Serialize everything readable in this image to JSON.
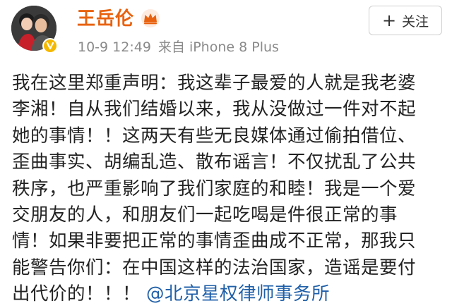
{
  "post": {
    "author": {
      "name": "王岳伦",
      "avatar": "avatar",
      "badge": "verified-badge-icon",
      "member_icon": "crown-icon"
    },
    "meta": {
      "time": "10-9 12:49",
      "source_prefix": "来自",
      "device": "iPhone 8 Plus"
    },
    "follow_button": {
      "icon": "plus-icon",
      "label": "关注"
    },
    "content": {
      "lines": [
        "我在这里郑重声明：我这辈子最爱的人就是我老婆",
        "李湘！自从我们结婚以来，我从没做过一件对不起",
        "她的事情！！这两天有些无良媒体通过偷拍借位、",
        "歪曲事实、胡编乱造、散布谣言！不仅扰乱了公共",
        "秩序，也严重影响了我们家庭的和睦！我是一个爱",
        "交朋友的人，和朋友们一起吃喝是件很正常的事",
        "情！如果非要把正常的事情歪曲成不正常，那我只",
        "能警告你们：在中国这样的法治国家，造谣是要付",
        "出代价的！！！"
      ],
      "mention": "@北京星权律师事务所"
    },
    "colors": {
      "username": "#e8620f",
      "meta": "#8a8a8a",
      "link": "#1f5fa8",
      "text": "#222222",
      "badge": "#f5b800"
    }
  }
}
